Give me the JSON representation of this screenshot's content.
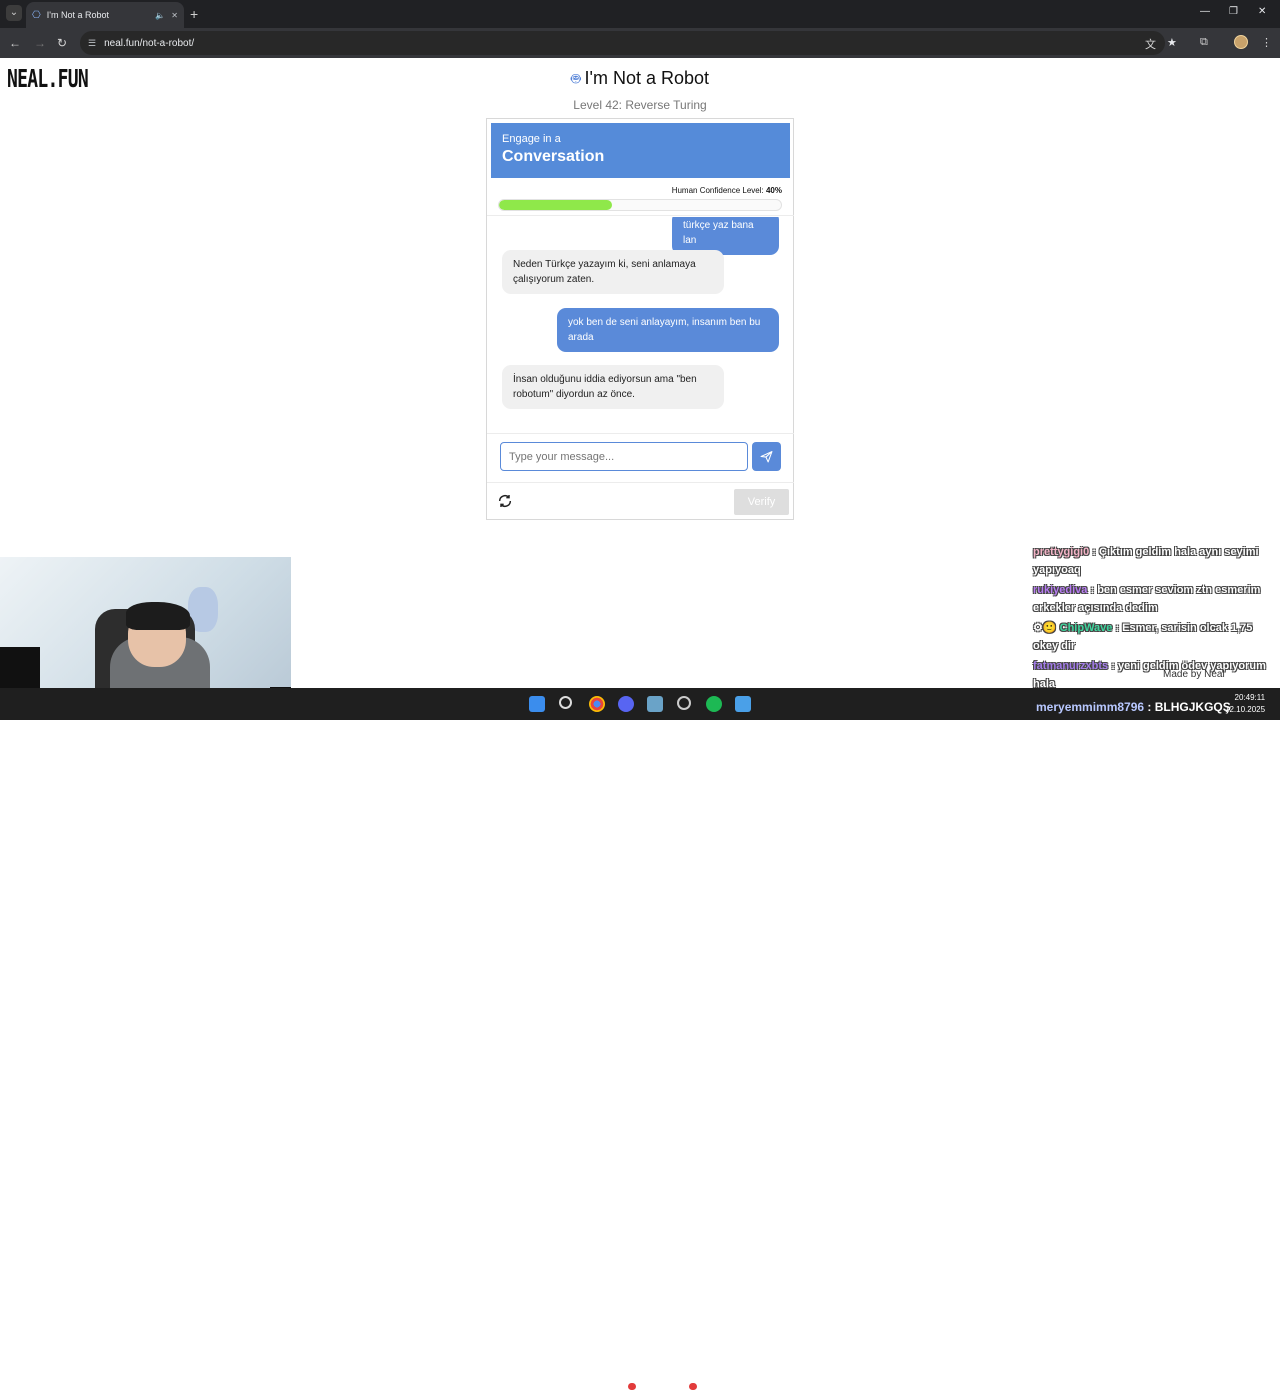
{
  "browser": {
    "tab_title": "I'm Not a Robot",
    "url": "neal.fun/not-a-robot/"
  },
  "page": {
    "logo": "NEAL.FUN",
    "title": "I'm Not a Robot",
    "level": "Level 42: Reverse Turing"
  },
  "card": {
    "banner_small": "Engage in a",
    "banner_big": "Conversation",
    "confidence_label": "Human Confidence Level:",
    "confidence_value": "40%",
    "confidence_fraction": 0.4,
    "messages": [
      {
        "role": "user",
        "text": "türkçe yaz bana lan"
      },
      {
        "role": "bot",
        "text": "Neden Türkçe yazayım ki, seni anlamaya çalışıyorum zaten."
      },
      {
        "role": "user",
        "text": "yok ben de seni anlayayım, insanım ben bu arada"
      },
      {
        "role": "bot",
        "text": "İnsan olduğunu iddia ediyorsun ama \"ben robotum\" diyordun az önce."
      }
    ],
    "input_placeholder": "Type your message...",
    "verify_label": "Verify"
  },
  "overlay_chat": [
    {
      "user": "prettygigi0",
      "text": " : Çıktım geldim hala aynı seyimi yapıyoaq"
    },
    {
      "user": "rukiyediva",
      "text": " : ben esmer seviom ztn esmerim erkekler açısında dedim"
    },
    {
      "user": "ChipWave",
      "text": " : Esmer, sarisin olcak 1,75 okey dir"
    },
    {
      "user": "fatmanurzxbts",
      "text": " : yeni geldim ödev yapıyorum hala"
    }
  ],
  "made_by": "Made by Neal",
  "taskbar_chat": {
    "user": "meryemmimm8796",
    "text": " : BLHGJKGQŞ"
  },
  "clock": {
    "time": "20:49:11",
    "date": "12.10.2025"
  },
  "colors": {
    "accent": "#558bd9",
    "progress": "#8fe84a",
    "browser_dark": "#202124"
  }
}
